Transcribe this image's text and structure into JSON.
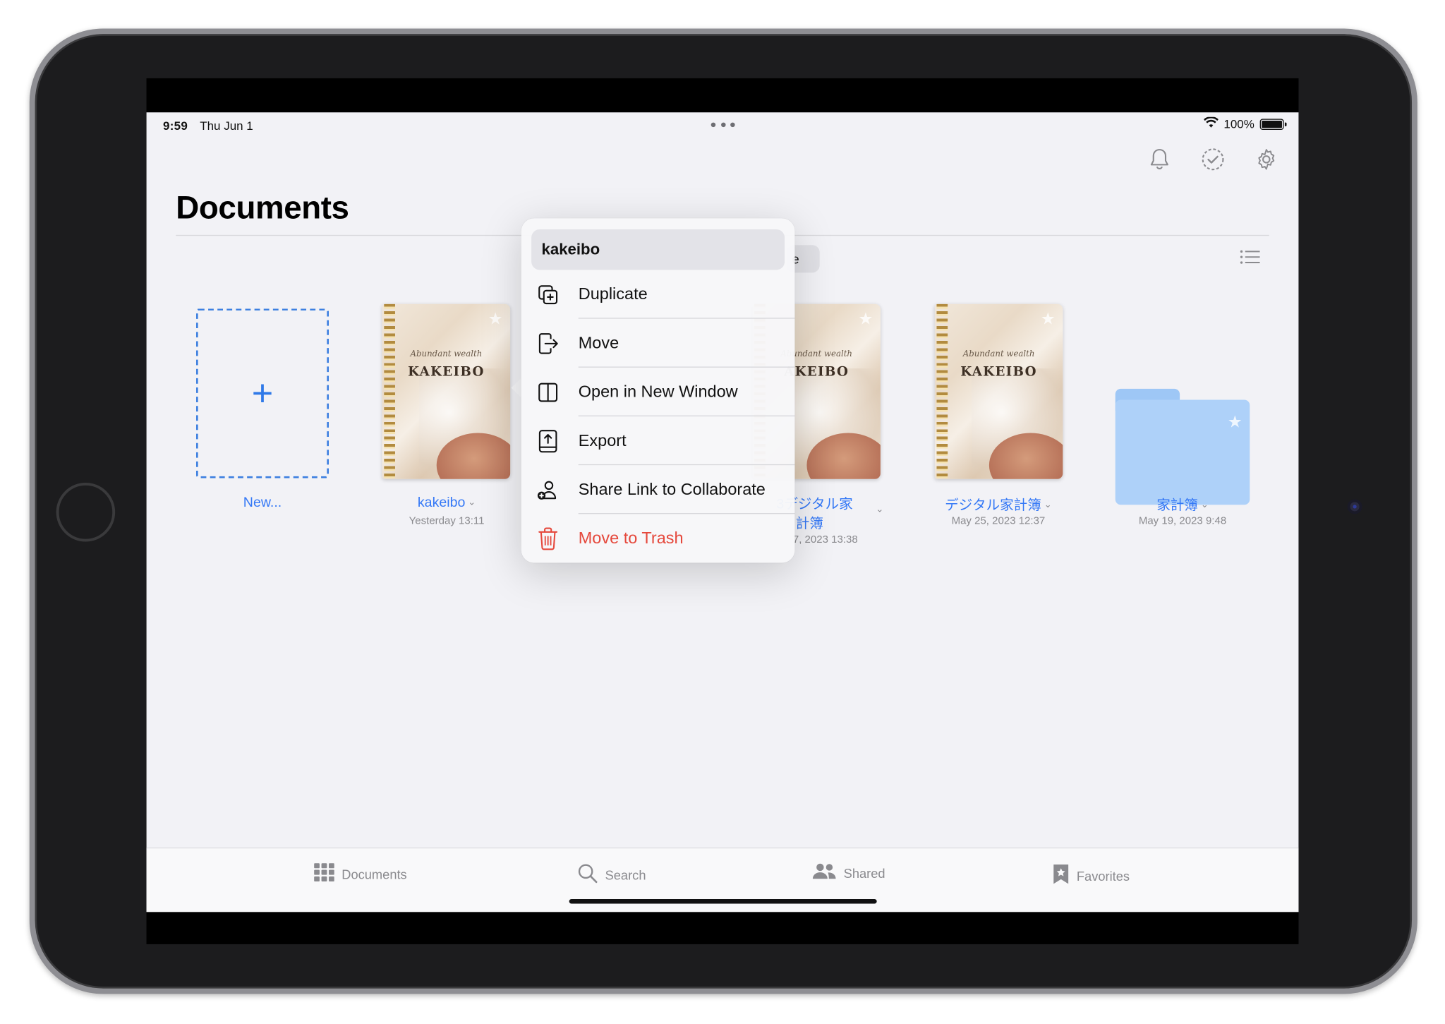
{
  "status_bar": {
    "time": "9:59",
    "date": "Thu Jun 1",
    "battery": "100%",
    "wifi_icon": "wifi-icon"
  },
  "toolbar_icons": [
    "bell-icon",
    "select-check-icon",
    "gear-icon"
  ],
  "page": {
    "title": "Documents"
  },
  "filter_chip": {
    "visible_text": "e"
  },
  "grid": {
    "new_tile": {
      "label": "New..."
    },
    "items": [
      {
        "name": "kakeibo",
        "date": "Yesterday 13:11",
        "type": "notebook",
        "cover_script": "Abundant wealth",
        "cover_title": "KAKEIBO"
      },
      {
        "name_line1": "3デジタル家",
        "name_line2": "計簿",
        "date": "7, 2023 13:38",
        "type": "notebook",
        "cover_script": "Abundant wealth",
        "cover_title": "AKEIBO"
      },
      {
        "name": "デジタル家計簿",
        "date": "May 25, 2023 12:37",
        "type": "notebook",
        "cover_script": "Abundant wealth",
        "cover_title": "KAKEIBO"
      },
      {
        "name": "家計簿",
        "date": "May 19, 2023 9:48",
        "type": "folder"
      }
    ]
  },
  "context_menu": {
    "header": "kakeibo",
    "items": [
      {
        "label": "Duplicate",
        "icon": "duplicate-icon",
        "danger": false
      },
      {
        "label": "Move",
        "icon": "move-icon",
        "danger": false
      },
      {
        "label": "Open in New Window",
        "icon": "split-window-icon",
        "danger": false
      },
      {
        "label": "Export",
        "icon": "export-icon",
        "danger": false
      },
      {
        "label": "Share Link to Collaborate",
        "icon": "share-collaborate-icon",
        "danger": false
      },
      {
        "label": "Move to Trash",
        "icon": "trash-icon",
        "danger": true
      }
    ]
  },
  "tab_bar": {
    "tabs": [
      {
        "label": "Documents",
        "icon": "grid-icon"
      },
      {
        "label": "Search",
        "icon": "search-icon"
      },
      {
        "label": "Shared",
        "icon": "people-icon"
      },
      {
        "label": "Favorites",
        "icon": "bookmark-star-icon"
      }
    ]
  },
  "colors": {
    "accent": "#3478f6",
    "danger": "#e5483c",
    "background": "#f2f2f6"
  }
}
